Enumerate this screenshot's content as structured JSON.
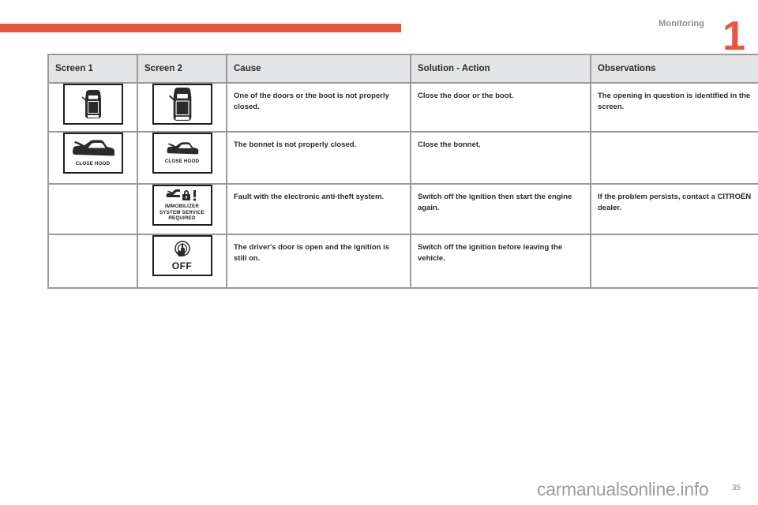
{
  "page": {
    "chapter_number": "1",
    "section_title": "Monitoring",
    "page_number": "35",
    "watermark": "carmanualsonline.info",
    "accent_color": "#e9553f",
    "header_fill": "#e3e4e6",
    "border_color": "#9a9a9a"
  },
  "table": {
    "columns": [
      {
        "key": "screen1",
        "label": "Screen 1"
      },
      {
        "key": "screen2",
        "label": "Screen 2"
      },
      {
        "key": "cause",
        "label": "Cause"
      },
      {
        "key": "solution",
        "label": "Solution - Action"
      },
      {
        "key": "observations",
        "label": "Observations"
      }
    ],
    "rows": [
      {
        "screen1": {
          "icon": "car-top-view-door-open-icon",
          "label": ""
        },
        "screen2": {
          "icon": "car-top-view-door-open-icon",
          "label": ""
        },
        "cause": "One of the doors or the boot is not properly closed.",
        "solution": "Close the door or the boot.",
        "observations": "The opening in question is identified in the screen."
      },
      {
        "screen1": {
          "icon": "car-side-hood-open-icon",
          "label": "CLOSE HOOD"
        },
        "screen2": {
          "icon": "car-side-hood-open-icon",
          "label": "CLOSE HOOD"
        },
        "cause": "The bonnet is not properly closed.",
        "solution": "Close the bonnet.",
        "observations": ""
      },
      {
        "screen1": {
          "icon": "",
          "label": ""
        },
        "screen2": {
          "icon": "immobilizer-lock-warning-icon",
          "label": "IMMOBILIZER SYSTEM SERVICE REQUIRED"
        },
        "cause": "Fault with the electronic anti-theft system.",
        "solution": "Switch off the ignition then start the engine again.",
        "observations": "If the problem persists, contact a CITROËN dealer."
      },
      {
        "screen1": {
          "icon": "",
          "label": ""
        },
        "screen2": {
          "icon": "ignition-key-off-icon",
          "label": "OFF"
        },
        "cause": "The driver's door is open and the ignition is still on.",
        "solution": "Switch off the ignition before leaving the vehicle.",
        "observations": ""
      }
    ]
  }
}
